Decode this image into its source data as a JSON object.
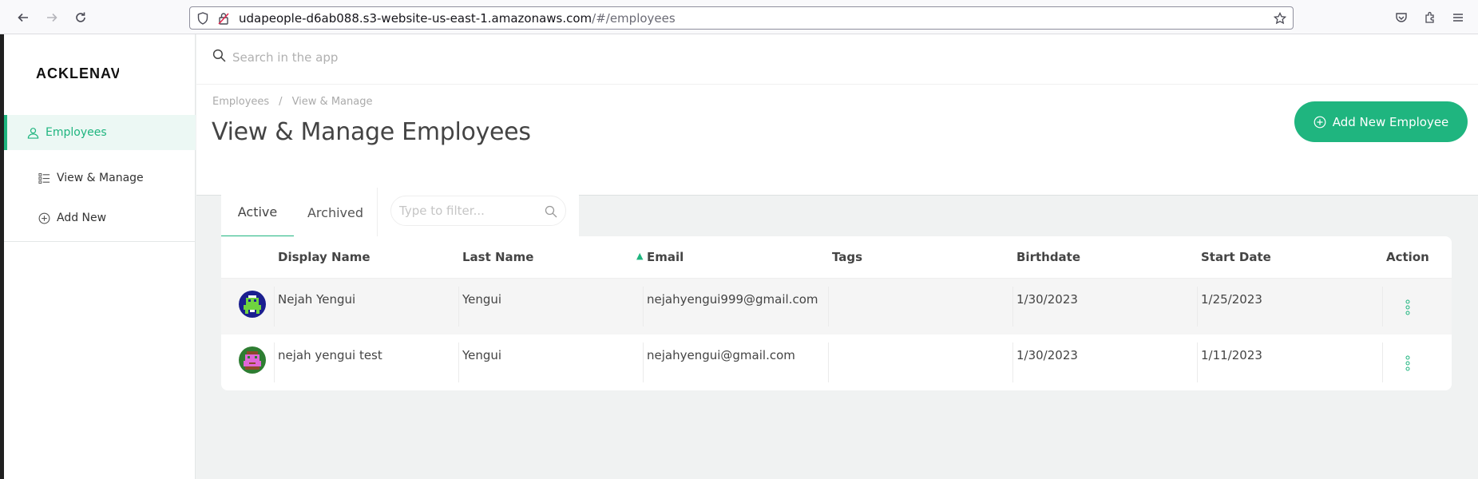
{
  "browser": {
    "url_host": "udapeople-d6ab088.s3-website-us-east-1.amazonaws.com",
    "url_path": "/#/employees"
  },
  "sidebar": {
    "logo": "ACKLENAVENUE",
    "items": [
      {
        "label": "Employees",
        "icon": "user-icon",
        "active": true
      },
      {
        "label": "View & Manage",
        "icon": "list-icon",
        "active": false
      },
      {
        "label": "Add New",
        "icon": "plus-circle-icon",
        "active": false
      }
    ]
  },
  "search": {
    "placeholder": "Search in the app"
  },
  "header": {
    "breadcrumb": [
      "Employees",
      "/",
      "View & Manage"
    ],
    "title": "View & Manage Employees",
    "add_button": "Add New Employee"
  },
  "tabs": {
    "items": [
      "Active",
      "Archived"
    ],
    "active": "Active",
    "filter_placeholder": "Type to filter..."
  },
  "table": {
    "columns": [
      "Display Name",
      "Last Name",
      "Email",
      "Tags",
      "Birthdate",
      "Start Date",
      "Action"
    ],
    "sorted_column": "Last Name",
    "rows": [
      {
        "display_name": "Nejah Yengui",
        "last_name": "Yengui",
        "email": "nejahyengui999@gmail.com",
        "tags": "",
        "birthdate": "1/30/2023",
        "start_date": "1/25/2023"
      },
      {
        "display_name": "nejah yengui test",
        "last_name": "Yengui",
        "email": "nejahyengui@gmail.com",
        "tags": "",
        "birthdate": "1/30/2023",
        "start_date": "1/11/2023"
      }
    ]
  },
  "colors": {
    "accent": "#1fb57f"
  }
}
